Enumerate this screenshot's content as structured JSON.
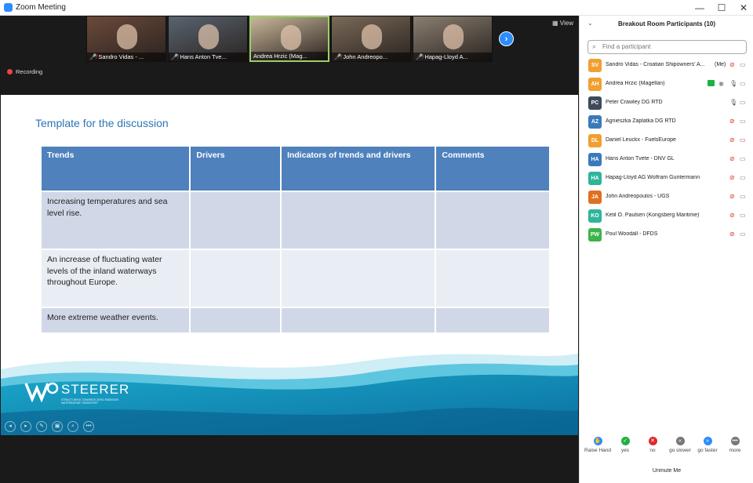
{
  "window": {
    "title": "Zoom Meeting"
  },
  "window_controls": {
    "minimize": "—",
    "maximize": "☐",
    "close": "✕"
  },
  "video_strip": {
    "thumbnails": [
      {
        "label": "Sandro Vidas - ...",
        "muted": true,
        "bg": "#6b4a3a"
      },
      {
        "label": "Hans Anton Tve...",
        "muted": true,
        "bg": "#5a6470"
      },
      {
        "label": "Andrea Hrzic (Mag...",
        "muted": false,
        "bg": "#c9b79a"
      },
      {
        "label": "John Andreopo...",
        "muted": true,
        "bg": "#7a6a58"
      },
      {
        "label": "Hapag-Lloyd A...",
        "muted": true,
        "bg": "#8a7f70"
      }
    ],
    "next_icon": "›",
    "view_label": "View"
  },
  "recording_label": "Recording",
  "slide": {
    "title": "Template for the discussion",
    "headers": [
      "Trends",
      "Drivers",
      "Indicators of trends and drivers",
      "Comments"
    ],
    "rows": [
      [
        "Increasing temperatures and sea level rise.",
        "",
        "",
        ""
      ],
      [
        "An increase of fluctuating water levels of the inland waterways throughout Europe.",
        "",
        "",
        ""
      ],
      [
        "More extreme weather events.",
        "",
        "",
        ""
      ]
    ],
    "logo_word": "STEERER",
    "logo_sub": "STRUCTURING TOWARDS ZERO EMISSION WATERBORNE TRANSPORT",
    "controls": [
      "◂",
      "▸",
      "✎",
      "▣",
      "⌕",
      "•••"
    ]
  },
  "panel": {
    "title": "Breakout Room Participants (10)",
    "search_placeholder": "Find a participant",
    "participants": [
      {
        "initials": "SV",
        "name": "Sandro Vidas - Croatian Shipowners' A...",
        "me": "(Me)",
        "color": "#f0a030",
        "mic": "muted",
        "cam": "on"
      },
      {
        "initials": "AH",
        "name": "Andrea Hrzic (Magellan)",
        "me": "",
        "color": "#f0a030",
        "mic": "live",
        "cam": "on",
        "sharing": true
      },
      {
        "initials": "PC",
        "name": "Peter Crawley DG RTD",
        "me": "",
        "color": "#3c4a5c",
        "mic": "live",
        "cam": "on"
      },
      {
        "initials": "AZ",
        "name": "Agnieszka Zaplatka DG RTD",
        "me": "",
        "color": "#3a7ab8",
        "mic": "muted",
        "cam": "on"
      },
      {
        "initials": "DL",
        "name": "Daniel Leuckx - FuelsEurope",
        "me": "",
        "color": "#f0a030",
        "mic": "muted",
        "cam": "off"
      },
      {
        "initials": "HA",
        "name": "Hans Anton Tvete - DNV GL",
        "me": "",
        "color": "#3a7ab8",
        "mic": "muted",
        "cam": "on"
      },
      {
        "initials": "HA",
        "name": "Hapag-Lloyd AG Wolfram Guntermann",
        "me": "",
        "color": "#2fb59a",
        "mic": "muted",
        "cam": "on"
      },
      {
        "initials": "JA",
        "name": "John Andreopoulos - UGS",
        "me": "",
        "color": "#e0701e",
        "mic": "muted",
        "cam": "on"
      },
      {
        "initials": "KO",
        "name": "Ketil O. Paulsen (Kongsberg Maritime)",
        "me": "",
        "color": "#2fb59a",
        "mic": "muted",
        "cam": "on"
      },
      {
        "initials": "PW",
        "name": "Poul Woodall - DFDS",
        "me": "",
        "color": "#3cb44a",
        "mic": "muted",
        "cam": "on"
      }
    ],
    "reactions": [
      {
        "label": "Raise Hand",
        "icon": "✋",
        "color": "#2d8cff"
      },
      {
        "label": "yes",
        "icon": "✓",
        "color": "#1fb040"
      },
      {
        "label": "no",
        "icon": "✕",
        "color": "#e02828"
      },
      {
        "label": "go slower",
        "icon": "«",
        "color": "#777777"
      },
      {
        "label": "go faster",
        "icon": "»",
        "color": "#2d8cff"
      },
      {
        "label": "more",
        "icon": "•••",
        "color": "#777777"
      }
    ],
    "unmute_label": "Unmute Me"
  },
  "colors": {
    "accent": "#2d8cff",
    "table_header": "#4f81bd",
    "slide_title": "#2e74b5"
  }
}
